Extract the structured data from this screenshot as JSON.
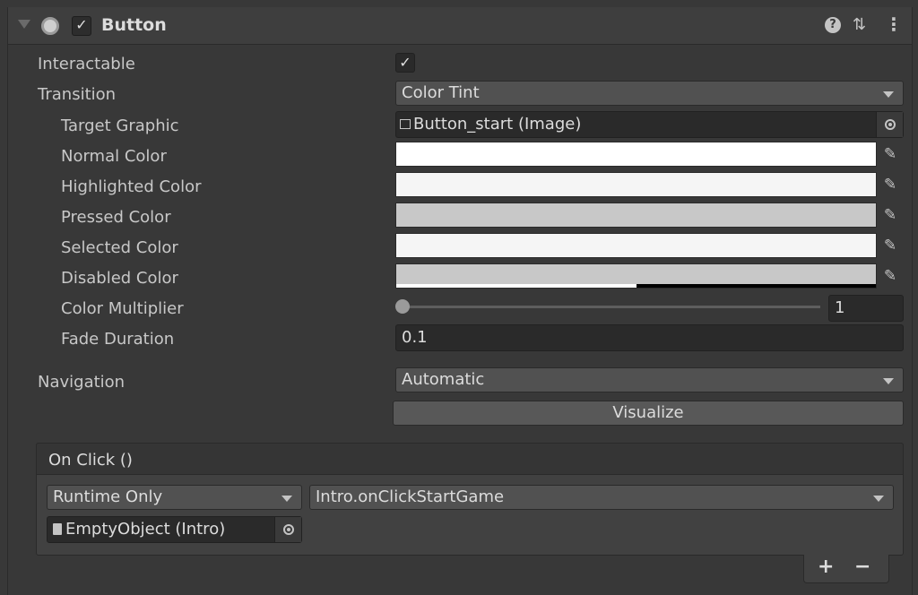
{
  "component": {
    "title": "Button",
    "enabled": true
  },
  "props": {
    "interactable_label": "Interactable",
    "interactable_value": true,
    "transition_label": "Transition",
    "transition_value": "Color Tint",
    "target_graphic_label": "Target Graphic",
    "target_graphic_value": "Button_start (Image)",
    "normal_color_label": "Normal Color",
    "highlighted_color_label": "Highlighted Color",
    "pressed_color_label": "Pressed Color",
    "selected_color_label": "Selected Color",
    "disabled_color_label": "Disabled Color",
    "color_multiplier_label": "Color Multiplier",
    "color_multiplier_value": "1",
    "color_multiplier_level": 0,
    "fade_duration_label": "Fade Duration",
    "fade_duration_value": "0.1",
    "navigation_label": "Navigation",
    "navigation_value": "Automatic",
    "visualize_label": "Visualize"
  },
  "colors": {
    "normal": "#ffffff",
    "highlighted": "#f5f5f5",
    "pressed": "#c8c8c8",
    "selected": "#f5f5f5",
    "disabled": "#c8c8c8"
  },
  "onclick": {
    "header": "On Click ()",
    "call_state": "Runtime Only",
    "function": "Intro.onClickStartGame",
    "target_object": "EmptyObject (Intro)",
    "add_label": "+",
    "remove_label": "−"
  },
  "icons": {
    "foldout": "triangle-down-icon",
    "component": "radio-icon",
    "help": "help-icon",
    "presets": "preset-sliders-icon",
    "more": "kebab-menu-icon",
    "eyedropper": "eyedropper-icon",
    "object_picker": "object-picker-icon"
  }
}
